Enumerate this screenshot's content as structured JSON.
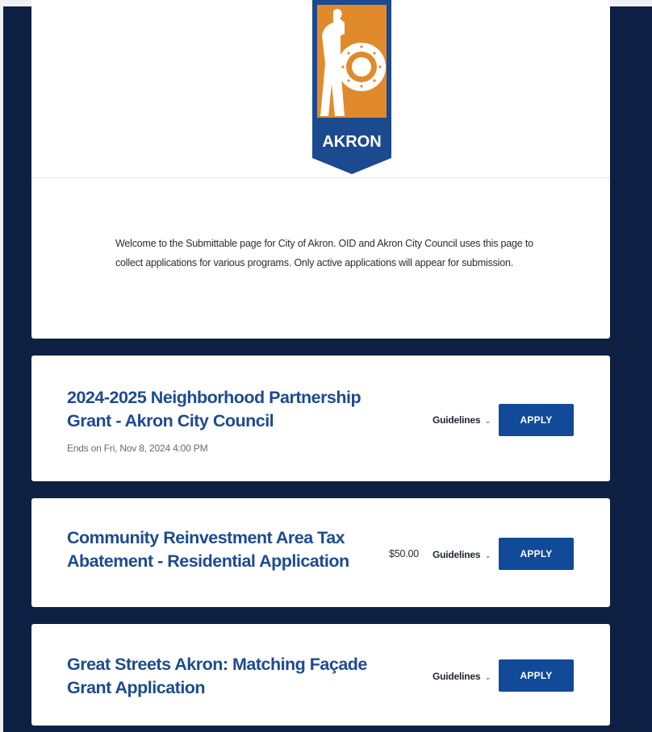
{
  "logo": {
    "text": "AKRON",
    "colors": {
      "navy": "#1b4a8f",
      "orange": "#e08a2c"
    }
  },
  "welcome": {
    "text": "Welcome to the Submittable page for City of Akron.  OID and Akron City Council uses this page to collect applications for various programs. Only active applications will appear for submission."
  },
  "applications": [
    {
      "title": "2024-2025 Neighborhood Partnership Grant - Akron City Council",
      "ends": "Ends on Fri, Nov 8, 2024 4:00 PM",
      "fee": "",
      "guidelines_label": "Guidelines",
      "apply_label": "APPLY"
    },
    {
      "title": "Community Reinvestment Area Tax Abatement - Residential Application",
      "ends": "",
      "fee": "$50.00",
      "guidelines_label": "Guidelines",
      "apply_label": "APPLY"
    },
    {
      "title": "Great Streets Akron: Matching Façade Grant Application",
      "ends": "",
      "fee": "",
      "guidelines_label": "Guidelines",
      "apply_label": "APPLY"
    }
  ],
  "theme": {
    "background": "#0d1f42",
    "accent": "#124a9a",
    "title_color": "#1d4b8f"
  }
}
